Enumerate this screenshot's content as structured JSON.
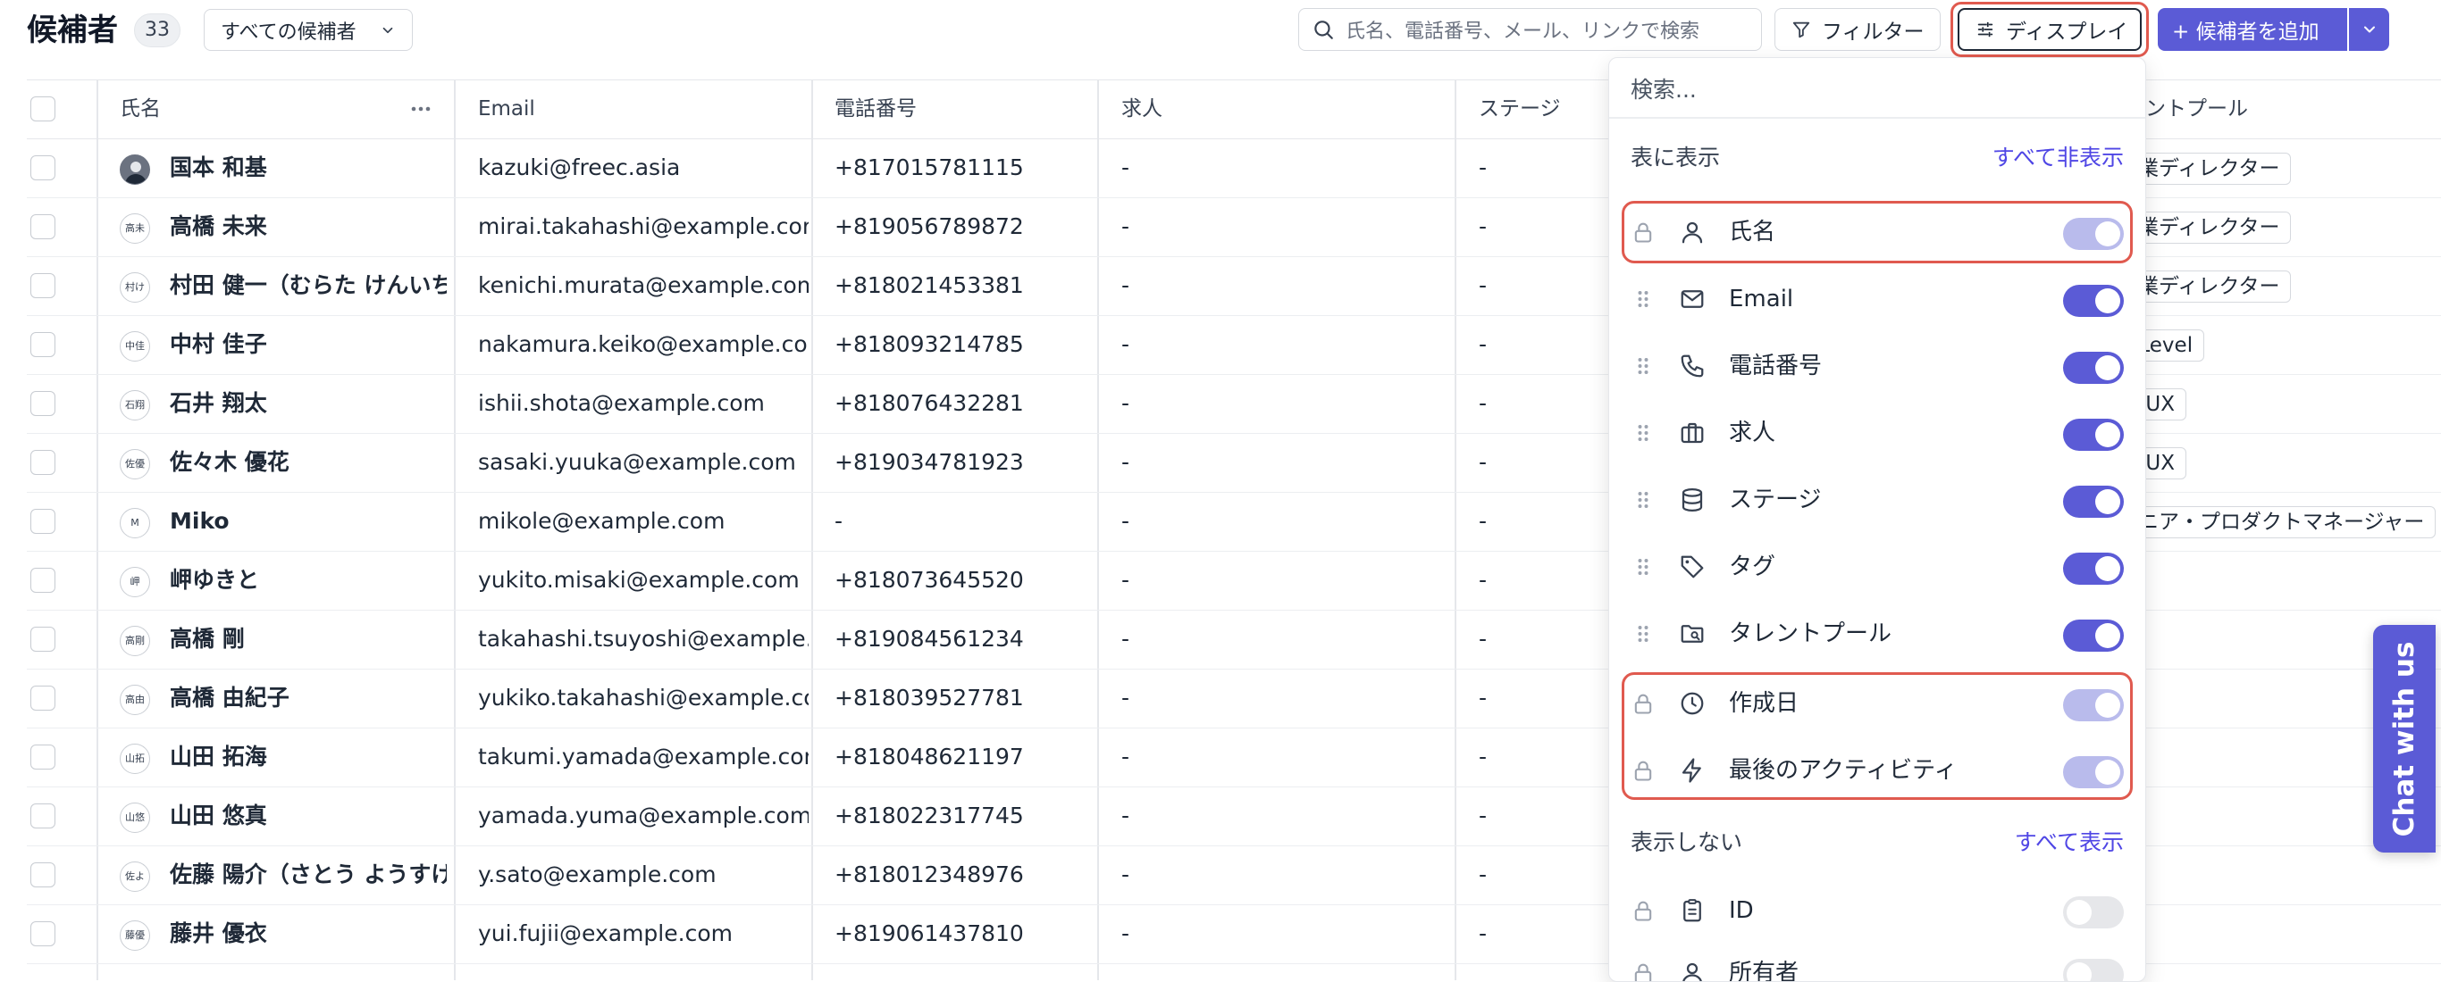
{
  "header": {
    "title": "候補者",
    "count": "33",
    "view_select": "すべての候補者",
    "search_placeholder": "氏名、電話番号、メール、リンクで検索",
    "filter_label": "フィルター",
    "display_label": "ディスプレイ",
    "add_label": "+ 候補者を追加"
  },
  "table": {
    "columns": [
      "氏名",
      "Email",
      "電話番号",
      "求人",
      "ステージ",
      "タレントプール"
    ],
    "rows": [
      {
        "avatar": "",
        "name": "国本 和基",
        "email": "kazuki@freec.asia",
        "phone": "+817015781115",
        "job": "-",
        "stage": "-",
        "pool": "営業ディレクター"
      },
      {
        "avatar": "高未",
        "name": "高橋 未来",
        "email": "mirai.takahashi@example.com",
        "phone": "+819056789872",
        "job": "-",
        "stage": "-",
        "pool": "営業ディレクター"
      },
      {
        "avatar": "村け",
        "name": "村田 健一（むらた けんいち）",
        "email": "kenichi.murata@example.com",
        "phone": "+818021453381",
        "job": "-",
        "stage": "-",
        "pool": "営業ディレクター"
      },
      {
        "avatar": "中佳",
        "name": "中村 佳子",
        "email": "nakamura.keiko@example.com",
        "phone": "+818093214785",
        "job": "-",
        "stage": "-",
        "pool": "C Level"
      },
      {
        "avatar": "石翔",
        "name": "石井 翔太",
        "email": "ishii.shota@example.com",
        "phone": "+818076432281",
        "job": "-",
        "stage": "-",
        "pool": "UI/UX"
      },
      {
        "avatar": "佐優",
        "name": "佐々木 優花",
        "email": "sasaki.yuuka@example.com",
        "phone": "+819034781923",
        "job": "-",
        "stage": "-",
        "pool": "UI/UX"
      },
      {
        "avatar": "M",
        "name": "Miko",
        "email": "mikole@example.com",
        "phone": "-",
        "job": "-",
        "stage": "-",
        "pool": "シニア・プロダクトマネージャー"
      },
      {
        "avatar": "岬",
        "name": "岬ゆきと",
        "email": "yukito.misaki@example.com",
        "phone": "+818073645520",
        "job": "-",
        "stage": "-",
        "pool": ""
      },
      {
        "avatar": "高剛",
        "name": "高橋 剛",
        "email": "takahashi.tsuyoshi@example.com",
        "phone": "+819084561234",
        "job": "-",
        "stage": "-",
        "pool": ""
      },
      {
        "avatar": "高由",
        "name": "高橋 由紀子",
        "email": "yukiko.takahashi@example.com",
        "phone": "+818039527781",
        "job": "-",
        "stage": "-",
        "pool": ""
      },
      {
        "avatar": "山拓",
        "name": "山田 拓海",
        "email": "takumi.yamada@example.com",
        "phone": "+818048621197",
        "job": "-",
        "stage": "-",
        "pool": ""
      },
      {
        "avatar": "山悠",
        "name": "山田 悠真",
        "email": "yamada.yuma@example.com",
        "phone": "+818022317745",
        "job": "-",
        "stage": "-",
        "pool": ""
      },
      {
        "avatar": "佐よ",
        "name": "佐藤 陽介（さとう ようすけ）",
        "email": "y.sato@example.com",
        "phone": "+818012348976",
        "job": "-",
        "stage": "-",
        "pool": ""
      },
      {
        "avatar": "藤優",
        "name": "藤井 優衣",
        "email": "yui.fujii@example.com",
        "phone": "+819061437810",
        "job": "-",
        "stage": "-",
        "pool": ""
      }
    ]
  },
  "display_panel": {
    "search_placeholder": "検索...",
    "shown_title": "表に表示",
    "hide_all": "すべて非表示",
    "hidden_title": "表示しない",
    "show_all": "すべて表示",
    "shown_fields": [
      {
        "label": "氏名",
        "icon": "person-icon",
        "locked": true,
        "state": "on-locked"
      },
      {
        "label": "Email",
        "icon": "mail-icon",
        "locked": false,
        "state": "on"
      },
      {
        "label": "電話番号",
        "icon": "phone-icon",
        "locked": false,
        "state": "on"
      },
      {
        "label": "求人",
        "icon": "briefcase-icon",
        "locked": false,
        "state": "on"
      },
      {
        "label": "ステージ",
        "icon": "database-icon",
        "locked": false,
        "state": "on"
      },
      {
        "label": "タグ",
        "icon": "tag-icon",
        "locked": false,
        "state": "on"
      },
      {
        "label": "タレントプール",
        "icon": "folder-search-icon",
        "locked": false,
        "state": "on"
      },
      {
        "label": "作成日",
        "icon": "clock-icon",
        "locked": true,
        "state": "on-locked"
      },
      {
        "label": "最後のアクティビティ",
        "icon": "lightning-icon",
        "locked": true,
        "state": "on-locked"
      }
    ],
    "hidden_fields": [
      {
        "label": "ID",
        "icon": "clipboard-icon",
        "locked": true,
        "state": "off"
      },
      {
        "label": "所有者",
        "icon": "person-icon",
        "locked": true,
        "state": "off"
      }
    ]
  },
  "chat": {
    "label": "Chat with us"
  },
  "colors": {
    "accent": "#5b5bd6",
    "highlight": "#e05a4f",
    "link": "#4f46e5"
  }
}
